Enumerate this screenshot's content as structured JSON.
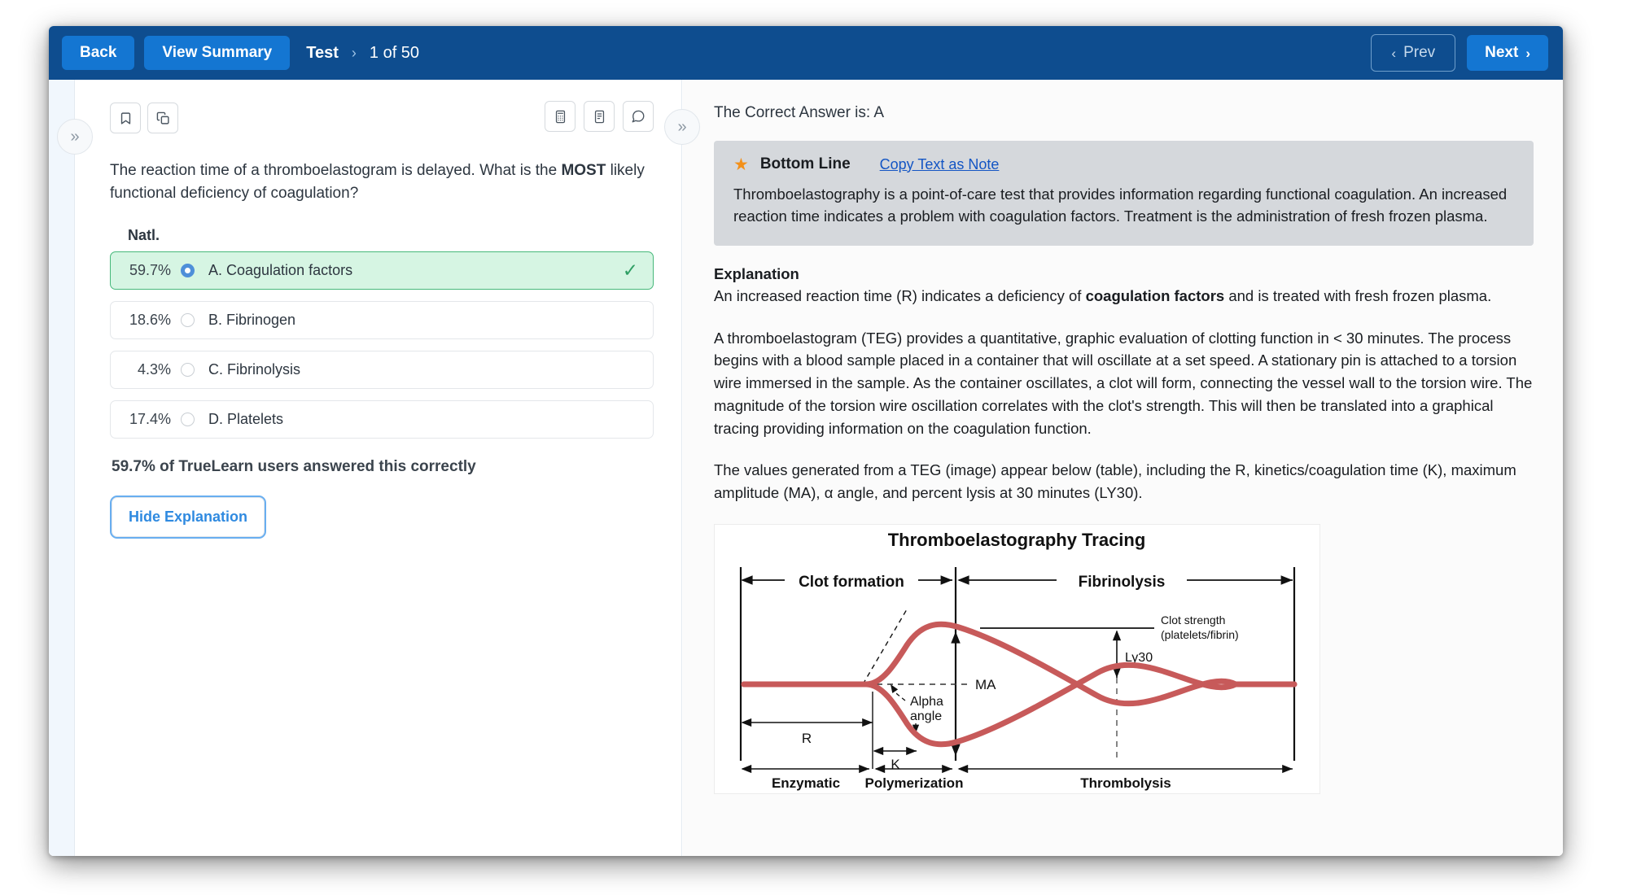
{
  "topbar": {
    "back_label": "Back",
    "view_summary_label": "View Summary",
    "breadcrumb_test": "Test",
    "breadcrumb_separator": "›",
    "breadcrumb_count": "1 of 50",
    "prev_label": "Prev",
    "next_label": "Next",
    "prev_chevron": "‹",
    "next_chevron": "›",
    "accent_color": "#1476d2",
    "bar_color": "#0e4d8f"
  },
  "panel_handles": {
    "left_expand": "»",
    "right_expand": "»"
  },
  "left_pane": {
    "tools_left": [
      {
        "name": "bookmark-icon",
        "label": "Bookmark"
      },
      {
        "name": "copy-icon",
        "label": "Copy"
      }
    ],
    "tools_right": [
      {
        "name": "calculator-icon",
        "label": "Calculator"
      },
      {
        "name": "notes-icon",
        "label": "Notes"
      },
      {
        "name": "chat-icon",
        "label": "Feedback"
      }
    ],
    "question_text_before": "The reaction time of a thromboelastogram is delayed. What is the ",
    "question_emphasis": "MOST",
    "question_text_after": " likely functional deficiency of coagulation?",
    "natl_header": "Natl.",
    "options": [
      {
        "pct": "59.7%",
        "label": "A. Coagulation factors",
        "selected": true,
        "correct": true
      },
      {
        "pct": "18.6%",
        "label": "B. Fibrinogen",
        "selected": false,
        "correct": false
      },
      {
        "pct": "4.3%",
        "label": "C. Fibrinolysis",
        "selected": false,
        "correct": false
      },
      {
        "pct": "17.4%",
        "label": "D. Platelets",
        "selected": false,
        "correct": false
      }
    ],
    "check_glyph": "✓",
    "stat_line": "59.7% of TrueLearn users answered this correctly",
    "hide_explanation_label": "Hide Explanation",
    "correct_color": "#d6f5e3",
    "correct_border": "#46b87a"
  },
  "right_pane": {
    "correct_answer_line": "The Correct Answer is: A",
    "bottom_line": {
      "star_glyph": "★",
      "title": "Bottom Line",
      "copy_link": "Copy Text as Note",
      "text": "Thromboelastography is a point-of-care test that provides information regarding functional coagulation. An increased reaction time indicates a problem with coagulation factors. Treatment is the administration of fresh frozen plasma.",
      "background": "#d5d8dc"
    },
    "explanation_title": "Explanation",
    "explanation_p1_before": "An increased reaction time (R) indicates a deficiency of ",
    "explanation_p1_bold": "coagulation factors",
    "explanation_p1_after": " and is treated with fresh frozen plasma.",
    "explanation_p2": "A thromboelastogram (TEG) provides a quantitative, graphic evaluation of clotting function in < 30 minutes. The process begins with a blood sample placed in a container that will oscillate at a set speed. A stationary pin is attached to a torsion wire immersed in the sample. As the container oscillates, a clot will form, connecting the vessel wall to the torsion wire. The magnitude of the torsion wire oscillation correlates with the clot's strength. This will then be translated into a graphical tracing providing information on the coagulation function.",
    "explanation_p3": "The values generated from a TEG (image) appear below (table), including the R, kinetics/coagulation time (K), maximum amplitude (MA), α angle, and percent lysis at 30 minutes (LY30)."
  },
  "figure": {
    "title": "Thromboelastography Tracing",
    "trace_color": "#c75a5a",
    "labels": {
      "clot_formation": "Clot formation",
      "fibrinolysis": "Fibrinolysis",
      "clot_strength_line1": "Clot strength",
      "clot_strength_line2": "(platelets/fibrin)",
      "ly30": "Ly30",
      "alpha_line1": "Alpha",
      "alpha_line2": "angle",
      "ma": "MA",
      "r": "R",
      "k": "K",
      "enzymatic": "Enzymatic",
      "polymerization": "Polymerization",
      "thrombolysis": "Thrombolysis"
    }
  }
}
